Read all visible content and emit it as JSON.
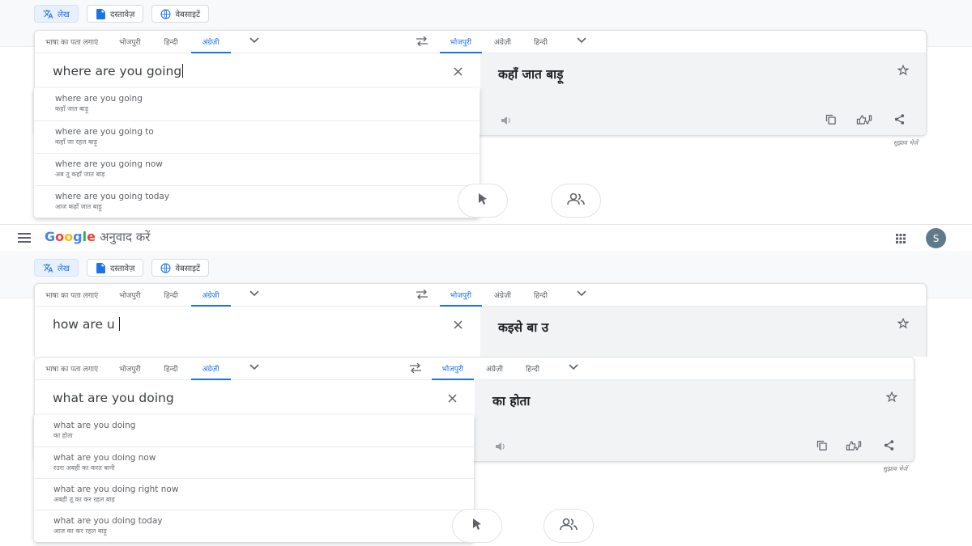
{
  "mode_buttons": {
    "text": "लेख",
    "documents": "दस्तावेज़",
    "websites": "वेबसाइटें"
  },
  "source_langs": {
    "detect": "भाषा का पता लगाएं",
    "bhojpuri": "भोजपुरी",
    "hindi": "हिन्दी",
    "english": "अंग्रेज़ी"
  },
  "target_langs": {
    "bhojpuri": "भोजपुरी",
    "english": "अंग्रेज़ी",
    "hindi": "हिन्दी"
  },
  "app": {
    "logo": "Google",
    "product": "अनुवाद करें",
    "avatar_letter": "S"
  },
  "panel1": {
    "source_text": "where are you going",
    "translation": "कहाँ जात बाड़ू",
    "feedback": "सुझाव भेजें",
    "suggestions": [
      {
        "en": "where are you going",
        "tr": "कहाँ जात बाड़ू"
      },
      {
        "en": "where are you going to",
        "tr": "कहाँ जा रहल बाड़ू"
      },
      {
        "en": "where are you going now",
        "tr": "अब तू कहाँ जात बाड़"
      },
      {
        "en": "where are you going today",
        "tr": "आज कहाँ जात बाड़ू"
      }
    ]
  },
  "panel2": {
    "source_text": "how are u",
    "translation": "कइसे बा उ"
  },
  "panel3": {
    "source_text": "what are you doing",
    "translation": "का होता",
    "feedback": "सुझाव भेजें",
    "suggestions": [
      {
        "en": "what are you doing",
        "tr": "का होता"
      },
      {
        "en": "what are you doing now",
        "tr": "रउरा अबहीं का करत बानी"
      },
      {
        "en": "what are you doing right now",
        "tr": "अबही तू का कर रहल बाड़"
      },
      {
        "en": "what are you doing today",
        "tr": "आज का कर रहल बाड़ू"
      }
    ]
  },
  "icons": {
    "text_mode": "translate-icon",
    "doc_mode": "document-icon",
    "web_mode": "globe-icon",
    "swap": "swap-arrows-icon",
    "clear": "close-icon",
    "star": "star-icon",
    "copy": "copy-icon",
    "rate": "thumbs-icon",
    "share": "share-icon",
    "speaker": "speaker-icon",
    "history": "history-cursor-icon",
    "contribute": "people-icon",
    "menu": "menu-icon",
    "apps": "apps-grid-icon"
  },
  "colors": {
    "accent": "#1a73e8",
    "target_bg": "#f1f3f4"
  }
}
